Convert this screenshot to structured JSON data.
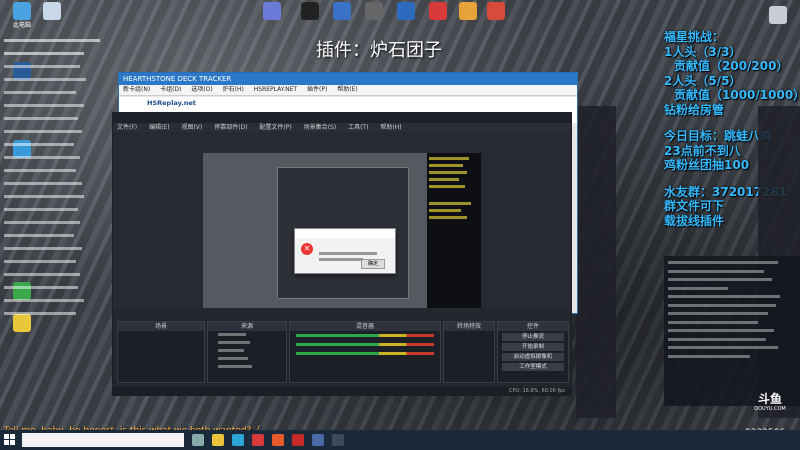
{
  "overlays": {
    "plugin_title": "插件：炉石团子",
    "left_lines": [
      "福星挑战：",
      "1人头（3/3）",
      "贡献值（200/200）",
      "2人头（5/5）",
      "贡献值（1000/1000）",
      "钻粉给房管",
      "",
      "今日目标：跳蛙八鸡",
      "23点前不到八",
      "鸡粉丝团抽100",
      "",
      "水友群：372017281",
      "群文件可下",
      "载拔线插件"
    ],
    "song": "Tell me, baby, be honest, is this what we both wanted?（",
    "viewer_count": "9332506"
  },
  "desktop_icons": [
    {
      "label": "此电脑",
      "color": "#4aa3e0"
    },
    {
      "label": "回收站",
      "color": "#8fb8d8"
    },
    {
      "label": "Windows Update",
      "color": "#9aa"
    }
  ],
  "hdt": {
    "title": "HEARTHSTONE DECK TRACKER",
    "menu": [
      "新卡组(N)",
      "卡组(D)",
      "选项(O)",
      "炉石(H)",
      "HSREPLAY.NET",
      "插件(P)",
      "帮助(E)"
    ],
    "tab_hsreplay": "HSReplay.net"
  },
  "obs": {
    "menu": [
      "文件(F)",
      "编辑(E)",
      "视图(V)",
      "停靠部件(D)",
      "配置文件(P)",
      "场景集合(S)",
      "工具(T)",
      "帮助(H)"
    ],
    "panels": {
      "scenes": "场景",
      "sources": "来源",
      "mixer": "混音器",
      "transitions": "转场特效",
      "controls": "控件"
    },
    "controls": [
      "停止推流",
      "开始录制",
      "启动虚拟摄像机",
      "工作室模式",
      "设置",
      "退出"
    ],
    "status": "CPU: 16.6%, 60.00 fps"
  },
  "dialog": {
    "title": "确定"
  },
  "douyu_logo": {
    "name": "斗鱼",
    "url": "DOUYU.COM"
  },
  "colors": {
    "overlay_blue": "#35b9ff",
    "taskbar": "#1b2a3a",
    "obs_bg": "#272a33"
  }
}
